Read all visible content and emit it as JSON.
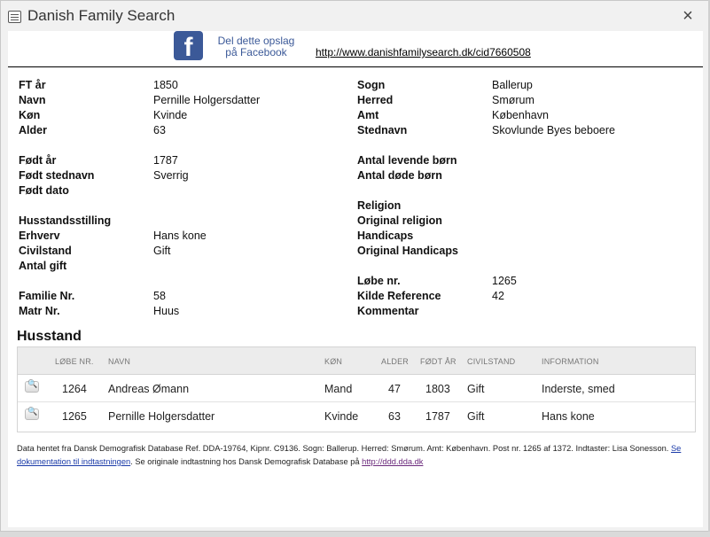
{
  "window": {
    "title": "Danish Family Search",
    "close_label": "×"
  },
  "share": {
    "facebook_logo": "f",
    "facebook_line1": "Del dette opslag",
    "facebook_line2": "på Facebook",
    "permalink": "http://www.danishfamilysearch.dk/cid7660508"
  },
  "left_fields": [
    {
      "label": "FT år",
      "value": "1850"
    },
    {
      "label": "Navn",
      "value": "Pernille Holgersdatter"
    },
    {
      "label": "Køn",
      "value": "Kvinde"
    },
    {
      "label": "Alder",
      "value": "63"
    },
    {
      "label": "Født år",
      "value": "1787"
    },
    {
      "label": "Født stednavn",
      "value": "Sverrig"
    },
    {
      "label": "Født dato",
      "value": ""
    },
    {
      "label": "Husstandsstilling",
      "value": ""
    },
    {
      "label": "Erhverv",
      "value": "Hans kone"
    },
    {
      "label": "Civilstand",
      "value": "Gift"
    },
    {
      "label": "Antal gift",
      "value": ""
    },
    {
      "label": "Familie Nr.",
      "value": "58"
    },
    {
      "label": "Matr Nr.",
      "value": "Huus"
    }
  ],
  "right_fields": [
    {
      "label": "Sogn",
      "value": "Ballerup"
    },
    {
      "label": "Herred",
      "value": "Smørum"
    },
    {
      "label": "Amt",
      "value": "København"
    },
    {
      "label": "Stednavn",
      "value": "Skovlunde Byes beboere"
    },
    {
      "label": "Antal levende børn",
      "value": ""
    },
    {
      "label": "Antal døde børn",
      "value": ""
    },
    {
      "label": "Religion",
      "value": ""
    },
    {
      "label": "Original religion",
      "value": ""
    },
    {
      "label": "Handicaps",
      "value": ""
    },
    {
      "label": "Original Handicaps",
      "value": ""
    },
    {
      "label": "Løbe nr.",
      "value": "1265"
    },
    {
      "label": "Kilde Reference",
      "value": "42"
    },
    {
      "label": "Kommentar",
      "value": ""
    }
  ],
  "household": {
    "title": "Husstand",
    "columns": [
      "LØBE NR.",
      "NAVN",
      "KØN",
      "ALDER",
      "FØDT ÅR",
      "CIVILSTAND",
      "INFORMATION"
    ],
    "rows": [
      {
        "lobe_nr": "1264",
        "navn": "Andreas Ømann",
        "kon": "Mand",
        "alder": "47",
        "fodt_ar": "1803",
        "civilstand": "Gift",
        "information": "Inderste, smed"
      },
      {
        "lobe_nr": "1265",
        "navn": "Pernille Holgersdatter",
        "kon": "Kvinde",
        "alder": "63",
        "fodt_ar": "1787",
        "civilstand": "Gift",
        "information": "Hans kone"
      }
    ]
  },
  "footer": {
    "text1": "Data hentet fra Dansk Demografisk Database Ref. DDA-19764, Kipnr. C9136. Sogn: Ballerup. Herred: Smørum. Amt: København. Post nr. 1265 af 1372. Indtaster: Lisa Sonesson. ",
    "link1": "Se dokumentation til indtastningen",
    "text2": ". Se originale indtastning hos Dansk Demografisk Database på ",
    "link2": "http://ddd.dda.dk"
  }
}
